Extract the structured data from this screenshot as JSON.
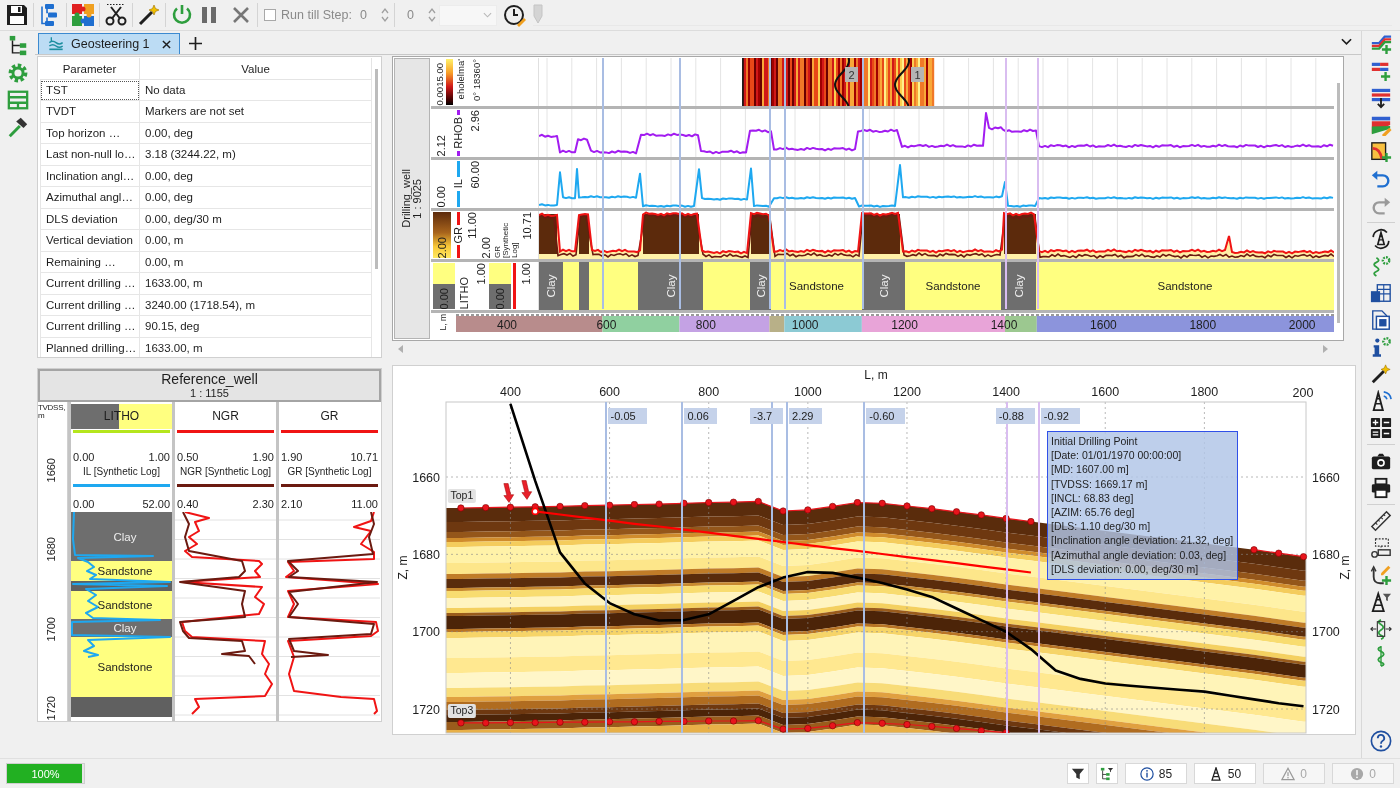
{
  "toolbar": {
    "run_till_step": {
      "label": "Run till Step:",
      "checked": false
    },
    "step_value": "0",
    "second_value": "0",
    "timeline": {
      "level": 0
    }
  },
  "tabs": [
    {
      "label": "Geosteering 1",
      "selected": true
    }
  ],
  "parameters": {
    "columns": [
      "Parameter",
      "Value"
    ],
    "rows": [
      {
        "parameter": "TST",
        "value": "No data",
        "selected": true
      },
      {
        "parameter": "TVDT",
        "value": "Markers are not set",
        "selected": false
      },
      {
        "parameter": "Top horizon …",
        "value": "0.00, deg",
        "selected": false
      },
      {
        "parameter": "Last non-null lo…",
        "value": "3.18 (3244.22, m)",
        "selected": false
      },
      {
        "parameter": "Inclination angl…",
        "value": "0.00, deg",
        "selected": false
      },
      {
        "parameter": "Azimuthal angl…",
        "value": "0.00, deg",
        "selected": false
      },
      {
        "parameter": "DLS deviation",
        "value": "0.00, deg/30 m",
        "selected": false
      },
      {
        "parameter": "Vertical deviation",
        "value": "0.00, m",
        "selected": false
      },
      {
        "parameter": "Remaining …",
        "value": "0.00, m",
        "selected": false
      },
      {
        "parameter": "Current drilling …",
        "value": "1633.00, m",
        "selected": false
      },
      {
        "parameter": "Current drilling …",
        "value": "3240.00 (1718.54), m",
        "selected": false
      },
      {
        "parameter": "Current drilling …",
        "value": "90.15, deg",
        "selected": false
      },
      {
        "parameter": "Planned drilling…",
        "value": "1633.00, m",
        "selected": false
      }
    ]
  },
  "drilling_well": {
    "name": "Drilling_well",
    "scale": "1 : 9025",
    "tracks": [
      {
        "kind": "image",
        "min": "0.00",
        "max": "15.00",
        "name": "eholelma'",
        "range": "0° 18360°",
        "markers": [
          "2",
          "1"
        ]
      },
      {
        "kind": "curve",
        "color": "#a21cf0",
        "min": "2.12",
        "name": "RHOB",
        "max": "2.96"
      },
      {
        "kind": "curve",
        "color": "#1ea8f0",
        "min": "0.00",
        "name": "IL",
        "max": "60.00"
      },
      {
        "kind": "filled-curve",
        "color": "#f01414",
        "min": "2.00",
        "name": "GR",
        "max": "11.00",
        "synthetic": {
          "min": "2.00",
          "name": "GR [Synthetic Log]",
          "max": "10.71"
        }
      },
      {
        "kind": "litho",
        "min": "0.00",
        "name": "LITHO",
        "max": "1.00",
        "synthetic": {
          "min": "0.00",
          "max": "1.00"
        },
        "labels": [
          {
            "kind": "clay",
            "label": "Clay"
          },
          {
            "kind": "clay",
            "label": "Clay"
          },
          {
            "kind": "clay",
            "label": "Clay"
          },
          {
            "kind": "sandstone",
            "label": "Sandstone"
          },
          {
            "kind": "clay",
            "label": "Clay"
          },
          {
            "kind": "sandstone",
            "label": "Sandstone"
          },
          {
            "kind": "clay",
            "label": "Clay"
          },
          {
            "kind": "sandstone",
            "label": "Sandstone"
          }
        ]
      }
    ],
    "ruler": {
      "label": "L, m",
      "ticks": [
        "400",
        "600",
        "800",
        "1000",
        "1200",
        "1400",
        "1600",
        "1800",
        "2000"
      ],
      "segments": [
        {
          "color": "#b88c8c"
        },
        {
          "color": "#90d0a0"
        },
        {
          "color": "#c4a2e4"
        },
        {
          "color": "#b8b088"
        },
        {
          "color": "#8ccad4"
        },
        {
          "color": "#e8a4d8"
        },
        {
          "color": "#9cc890"
        },
        {
          "color": "#8c94dc"
        }
      ]
    }
  },
  "reference_well": {
    "name": "Reference_well",
    "scale": "1 : 1155",
    "depth_label": "TVDSS, m",
    "depth_ticks": [
      "1660",
      "1680",
      "1700",
      "1720"
    ],
    "tracks": [
      {
        "kind": "litho",
        "curves": [
          {
            "title": "LITHO",
            "color": "#b5e61d",
            "min": "0.00",
            "max": "1.00"
          },
          {
            "title": "IL [Synthetic Log]",
            "color": "#1ea8f0",
            "min": "0.00",
            "max": "52.00"
          }
        ],
        "labels": [
          {
            "kind": "clay",
            "label": "Clay"
          },
          {
            "kind": "sandstone",
            "label": "Sandstone"
          },
          {
            "kind": "sandstone",
            "label": "Sandstone"
          },
          {
            "kind": "clay",
            "label": "Clay"
          },
          {
            "kind": "sandstone",
            "label": "Sandstone"
          }
        ]
      },
      {
        "kind": "curve",
        "curves": [
          {
            "title": "NGR",
            "color": "#f01414",
            "min": "0.50",
            "max": "1.90"
          },
          {
            "title": "NGR [Synthetic Log]",
            "color": "#6b1a10",
            "min": "0.40",
            "max": "2.30"
          }
        ]
      },
      {
        "kind": "curve",
        "curves": [
          {
            "title": "GR",
            "color": "#f01414",
            "min": "1.90",
            "max": "10.71"
          },
          {
            "title": "GR [Synthetic Log]",
            "color": "#6b1a10",
            "min": "2.10",
            "max": "11.00"
          }
        ]
      }
    ]
  },
  "section": {
    "chart_data": {
      "type": "line",
      "xlabel": "L, m",
      "ylabel": "Z, m",
      "y2label": "Z, m",
      "x": [
        300,
        350,
        400,
        450,
        500,
        550,
        600,
        650,
        700,
        750,
        800,
        850,
        900,
        950,
        1000,
        1050,
        1100,
        1150,
        1200,
        1250,
        1300,
        1350,
        1400,
        1450,
        1500,
        1550,
        1600,
        1650,
        1700,
        1750,
        1800,
        1850,
        1900,
        1950,
        2000
      ],
      "series": [
        {
          "name": "Top1",
          "color": "#e8141c",
          "values": [
            1668.0,
            1667.9,
            1667.8,
            1667.7,
            1667.6,
            1667.4,
            1667.3,
            1667.1,
            1667.0,
            1666.8,
            1666.6,
            1666.5,
            1666.3,
            1668.8,
            1668.5,
            1667.6,
            1666.6,
            1666.8,
            1667.5,
            1668.2,
            1669.0,
            1669.8,
            1670.7,
            1671.5,
            null,
            null,
            null,
            null,
            null,
            null,
            null,
            null,
            1678.8,
            1679.7,
            1680.6
          ]
        },
        {
          "name": "Top3",
          "color": "#e8141c",
          "values": [
            1723.6,
            1723.6,
            1723.5,
            1723.5,
            1723.4,
            1723.4,
            1723.3,
            1723.3,
            1723.2,
            1723.2,
            1723.1,
            1723.1,
            1723.0,
            1725.2,
            1725.0,
            1724.3,
            1723.5,
            1723.7,
            1724.0,
            1724.5,
            1725.0,
            1725.6,
            1726.1,
            null,
            null,
            null,
            null,
            null,
            null,
            null,
            null,
            null,
            null,
            null,
            null
          ]
        },
        {
          "color": "#000000",
          "values": [
            null,
            null,
            1641.1,
            1661.0,
            1679.5,
            1687.5,
            1692.6,
            1695.5,
            1697.1,
            1697.0,
            1695.5,
            1692.0,
            1688.5,
            1686.0,
            1684.6,
            1684.8,
            1686.0,
            1687.4,
            1689.1,
            1691.0,
            1694.0,
            1697.0,
            1700.0,
            1704.5,
            1710.0,
            1712.2,
            1713.4,
            1714.0,
            1714.5,
            1715.0,
            1715.5,
            1716.5,
            1717.5,
            1718.5,
            1719.3
          ]
        },
        {
          "color": "#ff0000",
          "values": [
            null,
            null,
            null,
            1668.9,
            1669.7,
            1670.5,
            1671.3,
            1672.1,
            1672.8,
            1673.6,
            1674.4,
            1675.2,
            1676.0,
            1676.8,
            1677.6,
            1678.4,
            1679.1,
            1679.9,
            1680.7,
            1681.5,
            1682.3,
            1683.1,
            1683.9,
            1684.7,
            null,
            null,
            null,
            null,
            null,
            null,
            null,
            null,
            null,
            null,
            null
          ]
        }
      ],
      "xlim": [
        270,
        2005
      ],
      "ylim": [
        1726.2,
        1640.6
      ],
      "y2lim": [
        1726.2,
        1640.6
      ],
      "xticks": [
        400,
        600,
        800,
        1000,
        1200,
        1400,
        1600,
        1800
      ],
      "yticks": [
        1660,
        1680,
        1700,
        1720
      ],
      "y2ticks": [
        1660,
        1680,
        1700,
        1720
      ],
      "grid": true
    },
    "segment_markers": [
      {
        "label": "-0.05",
        "color": "#a9bde3"
      },
      {
        "label": "0.06",
        "color": "#a9bde3"
      },
      {
        "label": "-3.7",
        "color": "#a9bde3"
      },
      {
        "label": "2.29",
        "color": "#a9bde3"
      },
      {
        "label": "-0.60",
        "color": "#a9bde3"
      },
      {
        "label": "-0.88",
        "color": "#d9bdf0"
      },
      {
        "label": "-0.92",
        "color": "#d9bdf0"
      }
    ],
    "edge_tick_label": "200",
    "tooltip": {
      "title": "Initial Drilling Point",
      "lines": [
        "[Date: 01/01/1970 00:00:00]",
        "[MD: 1607.00 m]",
        "[TVDSS: 1669.17 m]",
        "[INCL: 68.83 deg]",
        "[AZIM: 65.76 deg]",
        "[DLS: 1.10 deg/30 m]",
        "[Inclination angle deviation: 21.32, deg]",
        "[Azimuthal angle deviation: 0.03, deg]",
        "[DLS deviation: 0.00, deg/30 m]"
      ]
    }
  },
  "status_bar": {
    "progress": {
      "label": "100%",
      "level": 1
    },
    "counters": [
      {
        "kind": "info",
        "count": "85",
        "disabled": false
      },
      {
        "kind": "wells",
        "count": "50",
        "disabled": false
      },
      {
        "kind": "warnings",
        "count": "0",
        "disabled": true
      },
      {
        "kind": "errors",
        "count": "0",
        "disabled": true
      }
    ]
  }
}
